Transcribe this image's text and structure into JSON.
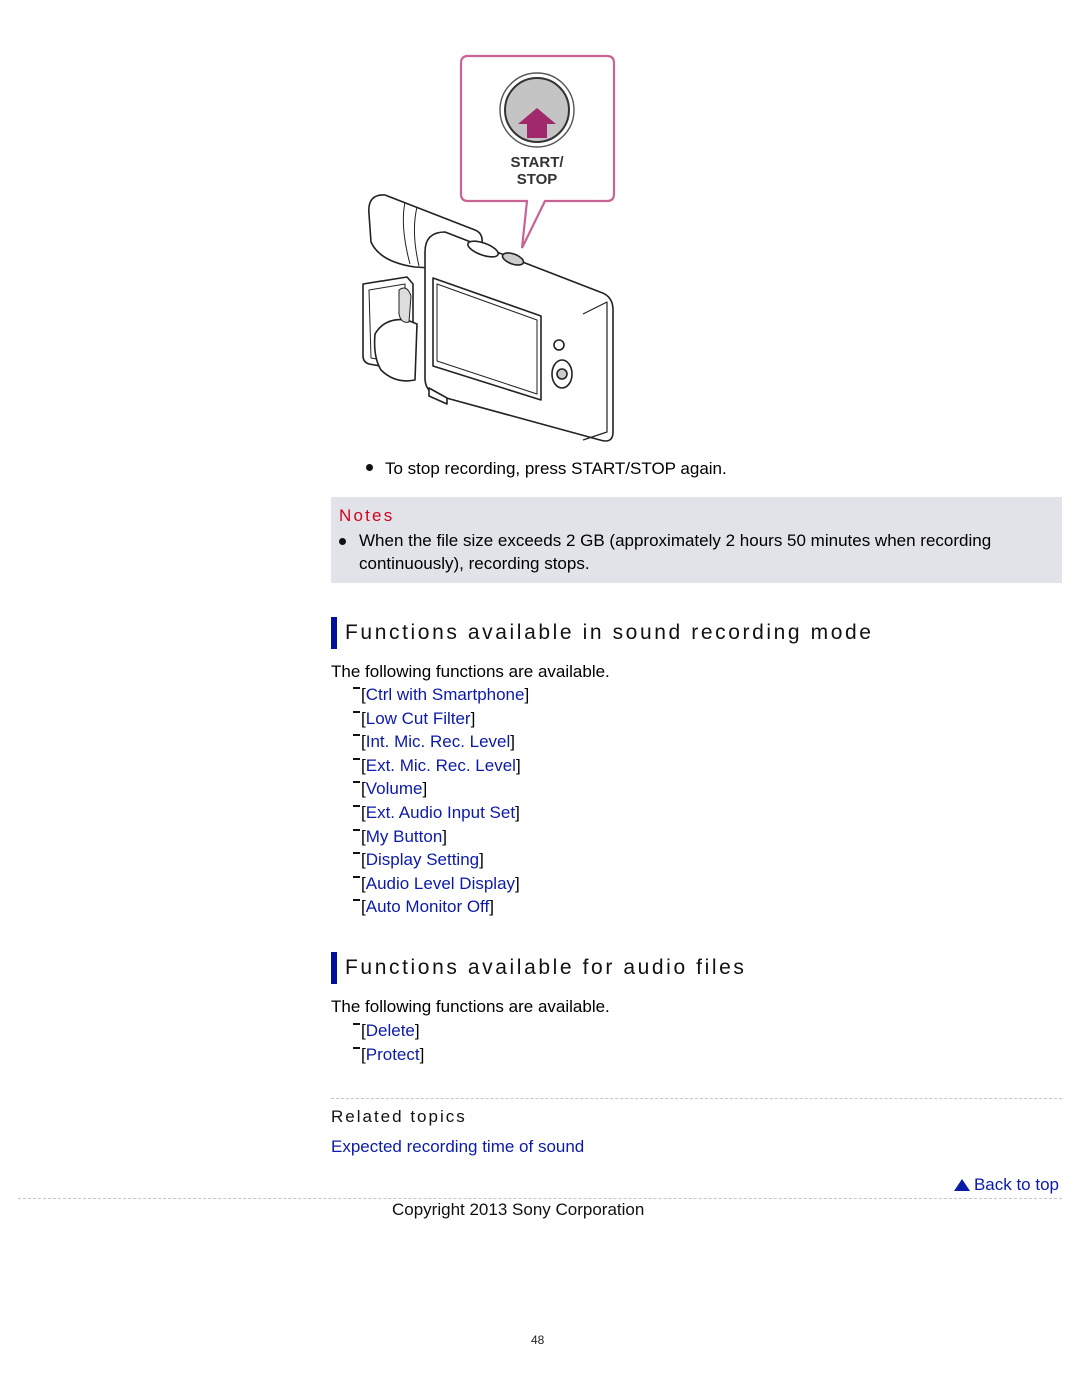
{
  "illustration": {
    "callout_label_line1": "START/",
    "callout_label_line2": "STOP",
    "description": "Recorder device with START/STOP button callout"
  },
  "stop_instruction": "To stop recording, press START/STOP again.",
  "notes": {
    "title": "Notes",
    "items": [
      "When the file size exceeds 2 GB (approximately 2 hours 50 minutes when recording continuously), recording stops."
    ]
  },
  "sections": [
    {
      "heading": "Functions available in sound recording mode",
      "intro": "The following functions are available.",
      "items": [
        "Ctrl with Smartphone",
        "Low Cut Filter",
        "Int. Mic. Rec. Level",
        "Ext. Mic. Rec. Level",
        "Volume",
        "Ext. Audio Input Set",
        "My Button",
        "Display Setting",
        "Audio Level Display",
        "Auto Monitor Off"
      ]
    },
    {
      "heading": "Functions available for audio files",
      "intro": "The following functions are available.",
      "items": [
        "Delete",
        "Protect"
      ]
    }
  ],
  "related": {
    "title": "Related topics",
    "links": [
      "Expected recording time of sound"
    ]
  },
  "back_to_top": "Back to top",
  "copyright": "Copyright 2013 Sony Corporation",
  "page_number": "48",
  "colors": {
    "link": "#0c1aa8",
    "heading_bar": "#00109a",
    "notes_title": "#d0021b",
    "notes_bg": "#e1e3e8",
    "callout": "#c86493",
    "button_arrow": "#a0286b"
  }
}
